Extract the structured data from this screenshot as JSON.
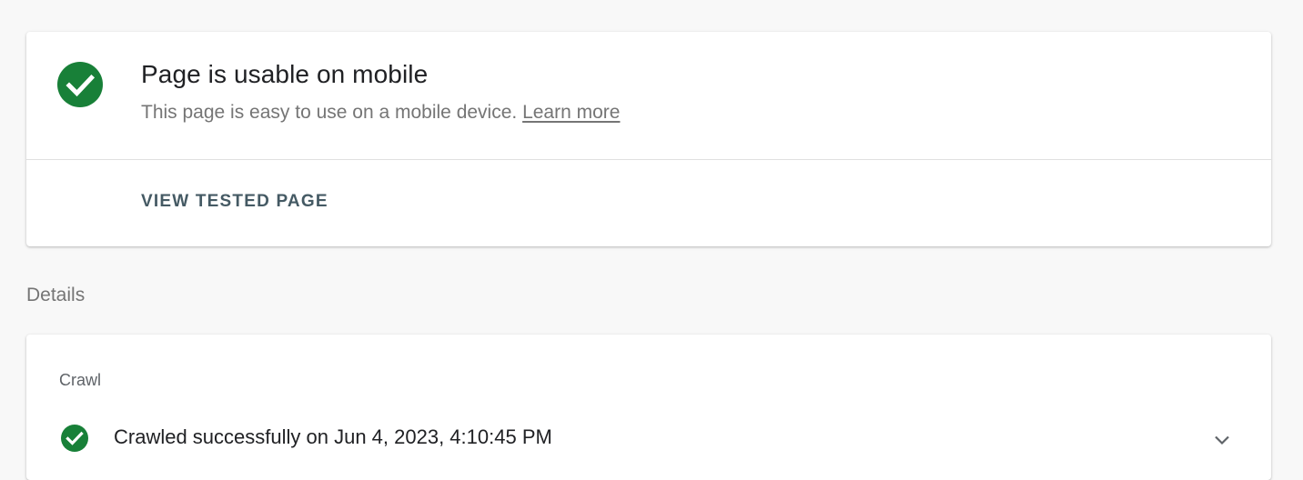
{
  "result": {
    "title": "Page is usable on mobile",
    "description": "This page is easy to use on a mobile device. ",
    "learn_more": "Learn more",
    "status_icon": "check-circle-icon",
    "view_tested_page": "VIEW TESTED PAGE"
  },
  "details": {
    "heading": "Details",
    "section_label": "Crawl",
    "crawl_status": "Crawled successfully on Jun 4, 2023, 4:10:45 PM",
    "crawl_icon": "check-circle-icon",
    "expand_icon": "chevron-down-icon"
  },
  "colors": {
    "success_green": "#188038",
    "background": "#f8f8f8",
    "card": "#ffffff",
    "button_text": "#455a64"
  }
}
